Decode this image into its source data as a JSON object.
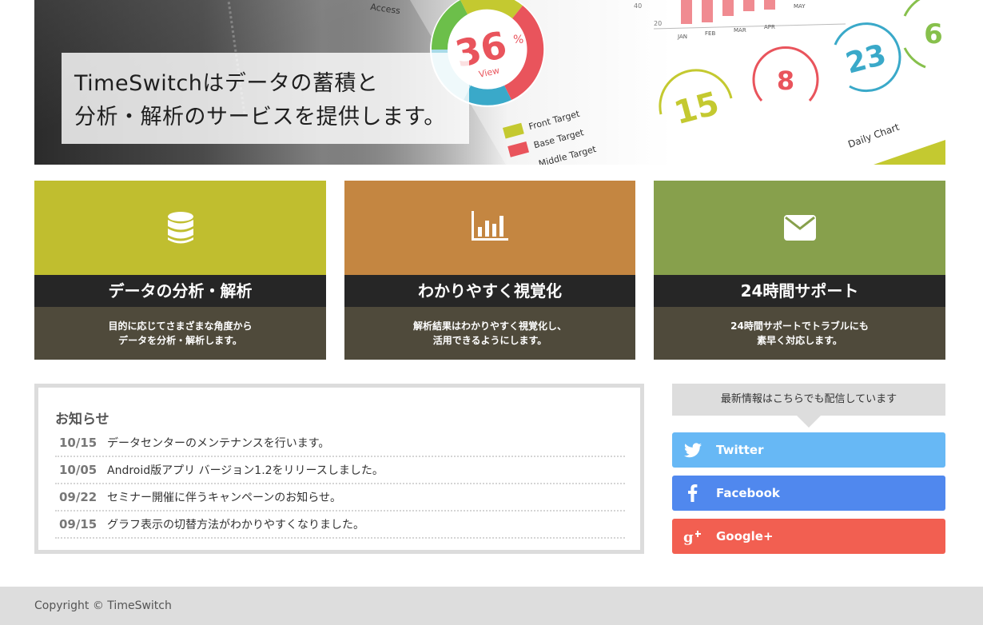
{
  "hero": {
    "caption": "TimeSwitchはデータの蓄積と\n分析・解析のサービスを提供します。",
    "graphic": {
      "donut_value": "36",
      "donut_unit": "%",
      "donut_label": "View",
      "access_label": "Access",
      "bar_axis_y": [
        "40",
        "20"
      ],
      "bar_months": [
        "JAN",
        "FEB",
        "MAR",
        "APR",
        "MAY"
      ],
      "circles": [
        "15",
        "8",
        "23",
        "6"
      ],
      "legend": [
        "Front Target",
        "Base Target",
        "Middle Target"
      ],
      "daily_chart": "Daily Chart"
    },
    "colors": {
      "green": "#c4c930",
      "red": "#e9545c",
      "blue": "#3aa9c9",
      "lightblue": "#a8dbe8"
    }
  },
  "features": [
    {
      "icon": "database-icon",
      "title": "データの分析・解析",
      "desc": "目的に応じてさまざまな角度から\nデータを分析・解析します。",
      "color": "#c0be2f"
    },
    {
      "icon": "bar-chart-icon",
      "title": "わかりやすく視覚化",
      "desc": "解析結果はわかりやすく視覚化し、\n活用できるようにします。",
      "color": "#c48641"
    },
    {
      "icon": "envelope-icon",
      "title": "24時間サポート",
      "desc": "24時間サポートでトラブルにも\n素早く対応します。",
      "color": "#87a04c"
    }
  ],
  "news": {
    "heading": "お知らせ",
    "items": [
      {
        "date": "10/15",
        "text": "データセンターのメンテナンスを行います。"
      },
      {
        "date": "10/05",
        "text": "Android版アプリ バージョン1.2をリリースしました。"
      },
      {
        "date": "09/22",
        "text": "セミナー開催に伴うキャンペーンのお知らせ。"
      },
      {
        "date": "09/15",
        "text": "グラフ表示の切替方法がわかりやすくなりました。"
      }
    ]
  },
  "social": {
    "heading": "最新情報はこちらでも配信しています",
    "buttons": [
      {
        "label": "Twitter",
        "icon": "twitter-icon",
        "color": "#67b8f5"
      },
      {
        "label": "Facebook",
        "icon": "facebook-icon",
        "color": "#5088ee"
      },
      {
        "label": "Google+",
        "icon": "google-plus-icon",
        "color": "#f25f51"
      }
    ]
  },
  "footer": {
    "copyright": "Copyright © TimeSwitch"
  }
}
